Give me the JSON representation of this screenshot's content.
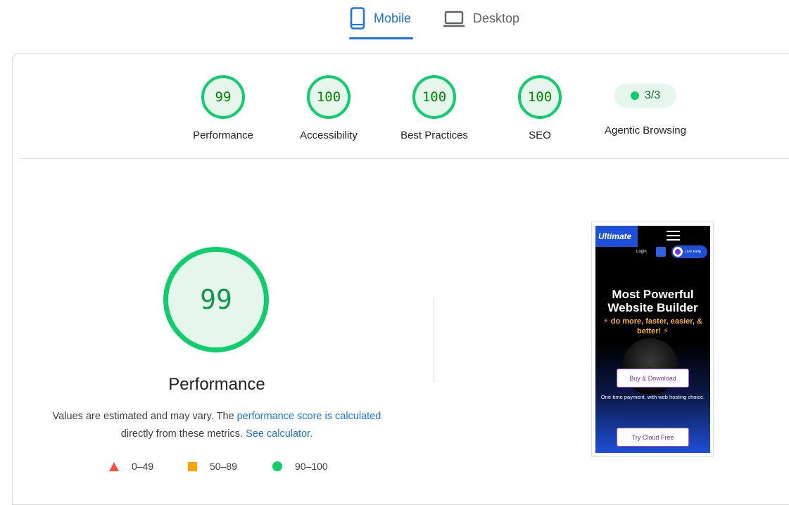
{
  "tabs": {
    "mobile_label": "Mobile",
    "desktop_label": "Desktop",
    "active": "Mobile"
  },
  "summary": {
    "performance": {
      "score": "99",
      "label": "Performance"
    },
    "accessibility": {
      "score": "100",
      "label": "Accessibility"
    },
    "best_practices": {
      "score": "100",
      "label": "Best Practices"
    },
    "seo": {
      "score": "100",
      "label": "SEO"
    },
    "agentic_browsing": {
      "score": "3/3",
      "label": "Agentic Browsing"
    }
  },
  "performance_section": {
    "score": "99",
    "title": "Performance",
    "desc_prefix": "Values are estimated and may vary. The ",
    "score_link": "performance score is calculated",
    "desc_middle": "directly from these metrics.",
    "calculator_link": "See calculator."
  },
  "legend": {
    "fail": "0–49",
    "average": "50–89",
    "pass": "90–100"
  },
  "thumbnail": {
    "logo_text": "Ultimate",
    "login": "Login",
    "live_help": "Live Help",
    "hero_title": "Most Powerful Website Builder",
    "hero_sub": "⚡ do more, faster, easier, & better! ⚡",
    "buy_button": "Buy & Download",
    "payment_note": "One-time payment, with web hosting choice.",
    "cloud_button": "Try Cloud Free"
  },
  "colors": {
    "accent": "#1a73e8",
    "pass": "#0cce6b",
    "pass_bg": "#e6f6ec",
    "average": "#ffa400",
    "fail": "#ff4e42"
  },
  "icons": {
    "mobile": "phone-icon",
    "desktop": "laptop-icon"
  }
}
